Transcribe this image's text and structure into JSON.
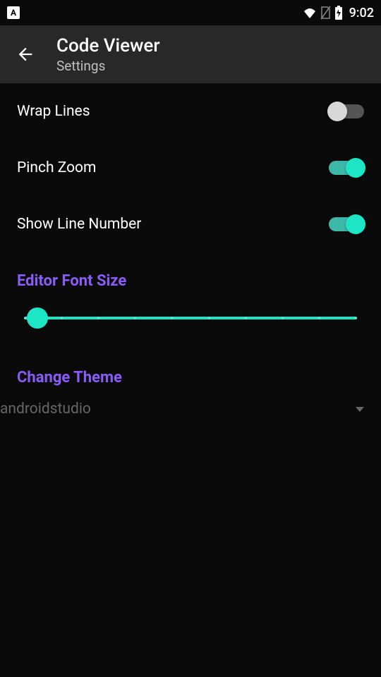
{
  "status_bar": {
    "clock": "9:02"
  },
  "app_bar": {
    "title": "Code Viewer",
    "subtitle": "Settings"
  },
  "settings": {
    "wrap_lines": {
      "label": "Wrap Lines",
      "enabled": false
    },
    "pinch_zoom": {
      "label": "Pinch Zoom",
      "enabled": true
    },
    "show_line_number": {
      "label": "Show Line Number",
      "enabled": true
    }
  },
  "sections": {
    "font_size": {
      "header": "Editor Font Size"
    },
    "theme": {
      "header": "Change Theme",
      "selected": "androidstudio"
    }
  },
  "colors": {
    "accent": "#1ce6c6",
    "section_header": "#8a5cf7",
    "background": "#0a0a0a",
    "app_bar": "#282828"
  }
}
